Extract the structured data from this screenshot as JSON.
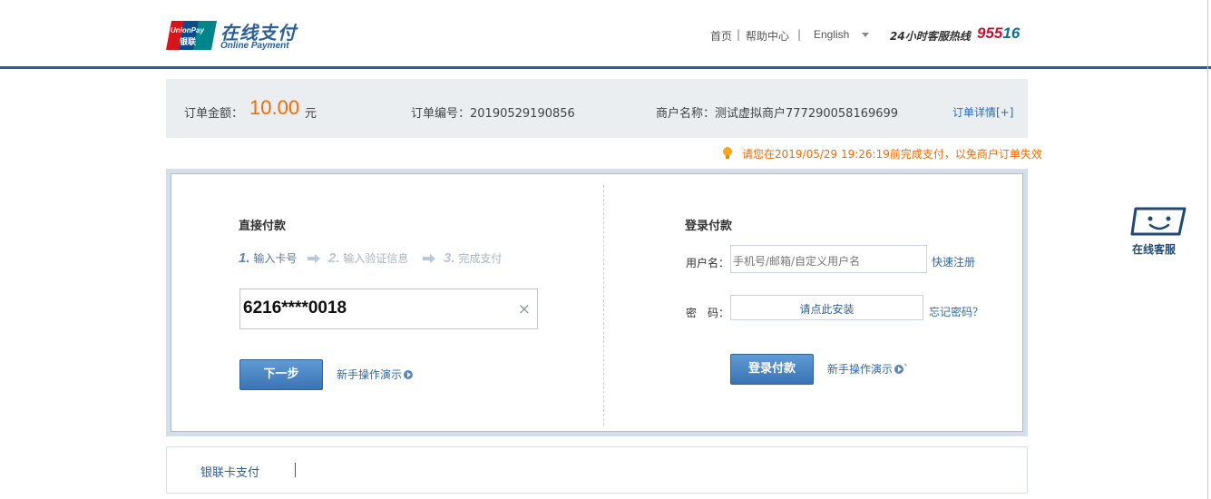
{
  "header": {
    "logo_cn": "在线支付",
    "logo_en": "Online Payment",
    "logo_badge": "UnionPay 银联",
    "nav_home": "首页",
    "nav_help": "帮助中心",
    "sep": "|",
    "language": "English",
    "hotline_label": "24小时客服热线",
    "hotline_number_a": "955",
    "hotline_number_b": "16"
  },
  "order": {
    "amount_label": "订单金额：",
    "amount": "10.00",
    "currency": "元",
    "order_no": "订单编号：20190529190856",
    "merchant": "商户名称：测试虚拟商户777290058169699",
    "detail_link": "订单详情[+]"
  },
  "notice": "请您在2019/05/29 19:26:19前完成支付，以免商户订单失效",
  "direct_pay": {
    "title": "直接付款",
    "steps": [
      {
        "num": "1.",
        "label": "输入卡号"
      },
      {
        "num": "2.",
        "label": "输入验证信息"
      },
      {
        "num": "3.",
        "label": "完成支付"
      }
    ],
    "card_value": "6216****0018",
    "clear_icon": "×",
    "next_button": "下一步",
    "demo_link": "新手操作演示"
  },
  "login_pay": {
    "title": "登录付款",
    "username_label": "用户名：",
    "username_placeholder": "手机号/邮箱/自定义用户名",
    "register_link": "快速注册",
    "password_label": "密　码：",
    "password_placeholder": "请点此安装",
    "forgot_link": "忘记密码？",
    "login_button": "登录付款",
    "demo_link": "新手操作演示",
    "demo_suffix": "`"
  },
  "tabs": {
    "card_pay": "银联卡支付"
  },
  "service": {
    "label": "在线客服"
  },
  "colors": {
    "brand_blue": "#2f5d9b",
    "amount_orange": "#ef6c00",
    "link_blue": "#2e6aa8",
    "hotline_red": "#c8102e",
    "hotline_teal": "#0e6f8e"
  }
}
